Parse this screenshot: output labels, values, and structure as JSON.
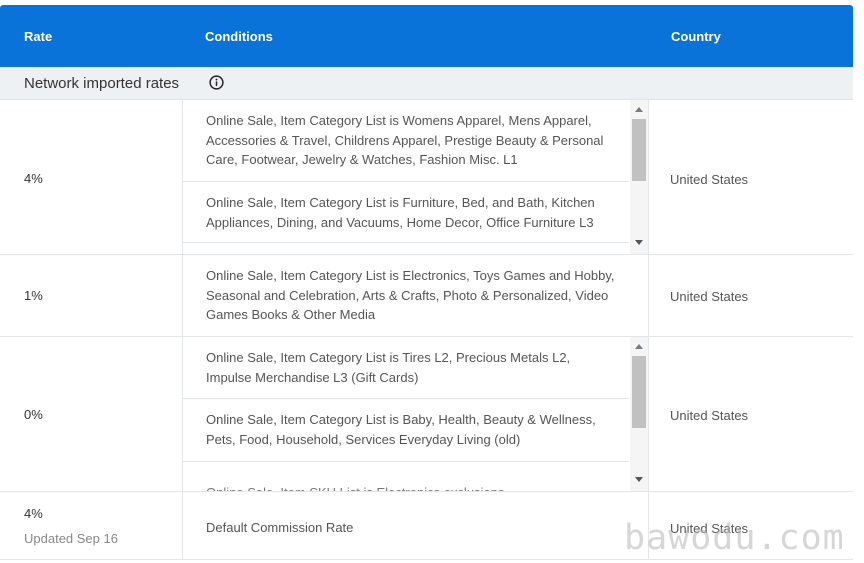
{
  "header": {
    "rate": "Rate",
    "conditions": "Conditions",
    "country": "Country"
  },
  "group": {
    "label": "Network imported rates",
    "icon": "info-icon"
  },
  "rows": [
    {
      "rate": "4%",
      "country": "United States",
      "conditions": [
        "Online Sale, Item Category List is Womens Apparel, Mens Apparel, Accessories & Travel, Childrens Apparel, Prestige Beauty & Personal Care, Footwear, Jewelry & Watches, Fashion Misc. L1",
        "Online Sale, Item Category List is Furniture, Bed, and Bath, Kitchen Appliances, Dining, and Vacuums, Home Decor, Office Furniture L3"
      ]
    },
    {
      "rate": "1%",
      "country": "United States",
      "conditions": [
        "Online Sale, Item Category List is Electronics, Toys Games and Hobby, Seasonal and Celebration, Arts & Crafts, Photo & Personalized, Video Games Books & Other Media"
      ]
    },
    {
      "rate": "0%",
      "country": "United States",
      "conditions": [
        "Online Sale, Item Category List is Tires L2, Precious Metals L2, Impulse Merchandise L3 (Gift Cards)",
        "Online Sale, Item Category List is Baby, Health, Beauty & Wellness, Pets, Food, Household, Services Everyday Living (old)",
        "Online Sale, Item SKU List is Electronics exclusions"
      ]
    },
    {
      "rate": "4%",
      "sub": "Updated Sep 16",
      "country": "United States",
      "conditions": [
        "Default Commission Rate"
      ]
    }
  ],
  "watermark": "bawodu.com"
}
